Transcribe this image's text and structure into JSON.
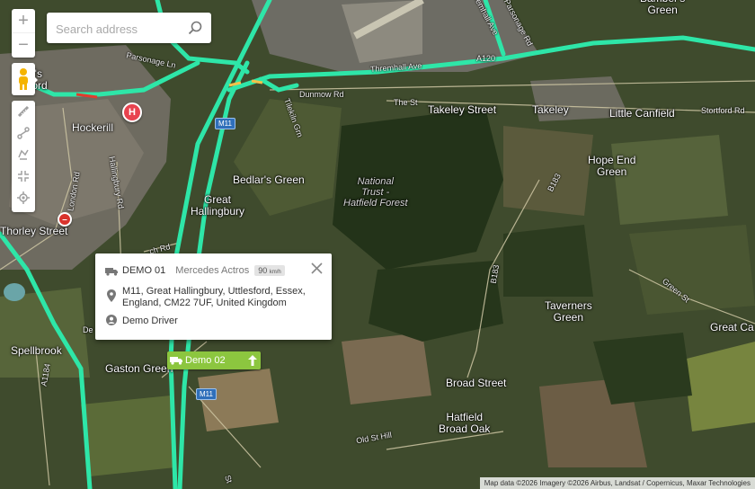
{
  "search": {
    "placeholder": "Search address"
  },
  "controls": {
    "zoom_in": "+",
    "zoom_out": "−",
    "tools": [
      "ruler-icon",
      "route-icon",
      "draw-icon",
      "fit-bounds-icon",
      "locate-icon"
    ]
  },
  "places": {
    "bishops_stortford_partial": "p's\nford",
    "hockerill": "Hockerill",
    "thorley_street": "Thorley Street",
    "bedlars_green": "Bedlar's Green",
    "great_hallingbury": "Great\nHallingbury",
    "national_trust": "National\nTrust -\nHatfield Forest",
    "takeley_street": "Takeley Street",
    "takeley": "Takeley",
    "little_canfield": "Little Canfield",
    "hope_end_green": "Hope End\nGreen",
    "barnbers_green": "Bamber's\nGreen",
    "taverners_green": "Taverners\nGreen",
    "great_cana": "Great Ca",
    "spellbrook": "Spellbrook",
    "gaston_green": "Gaston Green",
    "broad_street": "Broad Street",
    "hatfield_broad_oak": "Hatfield\nBroad Oak"
  },
  "roads": {
    "parsonage_ln": "Parsonage Ln",
    "parsonage_rd": "Parsonage Rd",
    "thremhall_ave": "Thremhall Ave",
    "a120": "A120",
    "dunmow_rd": "Dunmow Rd",
    "the_st": "The St",
    "stortford_rd": "Stortford Rd",
    "tilekiln_grn": "Tilekiln Grn",
    "hallingbury_rd": "Hallingbury Rd",
    "london_rd": "London Rd",
    "b183_north": "B183",
    "b183_south": "B183",
    "green_st": "Green St",
    "a1184": "A1184",
    "old_st_hill": "Old St Hill",
    "church_rd": "ch Rd",
    "m11_top": "M11",
    "m11_bottom": "M11",
    "de": "De",
    "st": "St"
  },
  "markers": {
    "hospital": "H",
    "no_entry": "–"
  },
  "popup": {
    "vehicle_name": "DEMO 01",
    "vehicle_model": "Mercedes Actros",
    "speed_value": "90",
    "speed_unit": "km/h",
    "address": "M11, Great Hallingbury, Uttlesford, Essex, England, CM22 7UF, United Kingdom",
    "driver": "Demo Driver"
  },
  "vehicle_tag": {
    "label": "Demo 02"
  },
  "attribution": "Map data ©2026 Imagery ©2026 Airbus, Landsat / Copernicus, Maxar Technologies",
  "colors": {
    "motorway": "#2ee6a8",
    "vehicle_tag": "#8cc63f",
    "hospital": "#e8434f",
    "no_entry": "#d9332c",
    "pegman": "#f5b400"
  }
}
